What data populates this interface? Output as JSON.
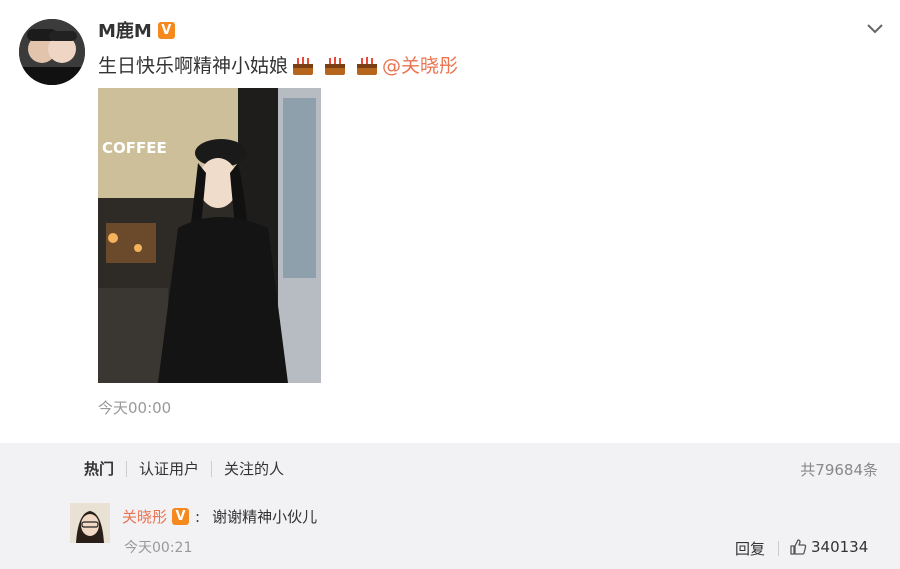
{
  "post": {
    "username": "M鹿M",
    "verified_badge": "V",
    "text": "生日快乐啊精神小姑娘",
    "emoji": [
      "cake-icon",
      "cake-icon",
      "cake-icon"
    ],
    "mention": "@关晓彤",
    "photo_sign_text": "COFFEE",
    "time": "今天00:00"
  },
  "comments": {
    "tabs": [
      "热门",
      "认证用户",
      "关注的人"
    ],
    "total": "共79684条",
    "items": [
      {
        "user": "关晓彤",
        "verified_badge": "V",
        "colon": ":",
        "text": "谢谢精神小伙儿",
        "time": "今天00:21",
        "reply_label": "回复",
        "likes": "340134"
      }
    ]
  },
  "colors": {
    "accent": "#eb7350",
    "badge": "#f5891d",
    "comment_bg": "#f2f2f5"
  }
}
